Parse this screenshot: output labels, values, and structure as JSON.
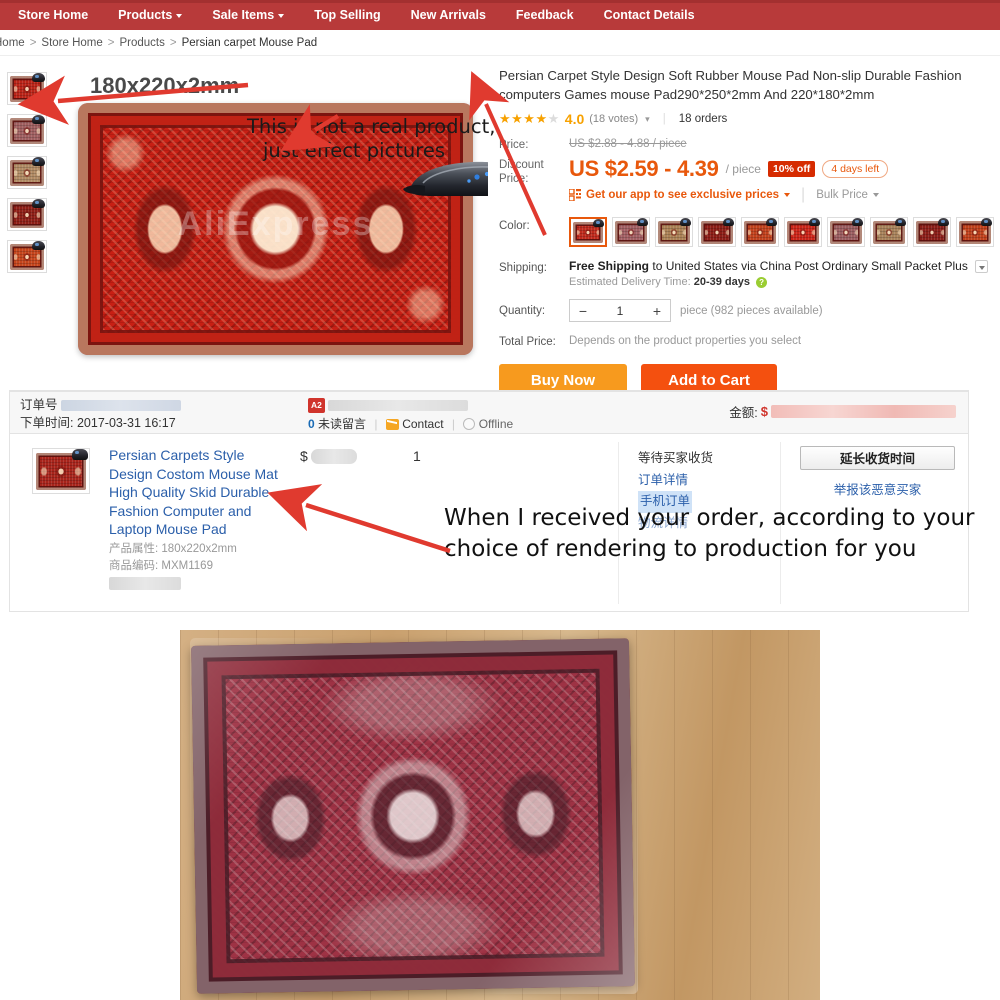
{
  "nav": {
    "items": [
      {
        "label": "Store Home",
        "has_caret": false
      },
      {
        "label": "Products",
        "has_caret": true
      },
      {
        "label": "Sale Items",
        "has_caret": true
      },
      {
        "label": "Top Selling",
        "has_caret": false
      },
      {
        "label": "New Arrivals",
        "has_caret": false
      },
      {
        "label": "Feedback",
        "has_caret": false
      },
      {
        "label": "Contact Details",
        "has_caret": false
      }
    ]
  },
  "breadcrumb": {
    "home": "Home",
    "store_home": "Store Home",
    "products": "Products",
    "current": "Persian carpet Mouse Pad",
    "separator": ">"
  },
  "annotations": {
    "top_line1": "This is not a real product,",
    "top_line2": "just effect pictures",
    "bottom": "When I received your order, according to your choice of rendering to production for you",
    "arrow_color": "#e03a2f"
  },
  "gallery": {
    "size_label": "180x220x2mm",
    "watermark": "AliExpress",
    "thumbnails": [
      {
        "name": "thumb-red-medallion",
        "color": "#b9261c"
      },
      {
        "name": "thumb-rose-gray",
        "color": "#9e5a5c"
      },
      {
        "name": "thumb-tan-beige",
        "color": "#a9apparent"
      },
      {
        "name": "thumb-dark-red",
        "color": "#8e1f18"
      },
      {
        "name": "thumb-orange-red",
        "color": "#c3421c"
      }
    ]
  },
  "product": {
    "title": "Persian Carpet Style Design Soft Rubber Mouse Pad Non-slip Durable Fashion computers Games mouse Pad290*250*2mm And 220*180*2mm",
    "rating": "4.0",
    "stars_filled": 4,
    "stars_total": 5,
    "votes": "(18 votes)",
    "orders": "18 orders",
    "price_label": "Price:",
    "original_price": "US $2.88 - 4.88 / piece",
    "discount_label_line1": "Discount",
    "discount_label_line2": "Price:",
    "discount_price": "US $2.59 - 4.39",
    "per_unit": "/ piece",
    "discount_badge": "10% off",
    "time_left_badge": "4 days left",
    "app_promo": "Get our app to see exclusive prices",
    "bulk_price": "Bulk Price",
    "color_label": "Color:",
    "shipping_label": "Shipping:",
    "shipping_free": "Free Shipping",
    "shipping_rest": "to United States via China Post Ordinary Small Packet Plus",
    "edt_label": "Estimated Delivery Time:",
    "edt_value": "20-39 days",
    "quantity_label": "Quantity:",
    "quantity_value": "1",
    "quantity_minus": "−",
    "quantity_plus": "+",
    "quantity_note": "piece (982 pieces available)",
    "total_price_label": "Total Price:",
    "total_price_value": "Depends on the product properties you select",
    "buy_now": "Buy Now",
    "add_to_cart": "Add to Cart",
    "accent_orange": "#e8580c",
    "buy_now_color": "#f79a1e",
    "add_cart_color": "#f4500f"
  },
  "order": {
    "order_no_label": "订单号",
    "order_time_label": "下单时间:",
    "order_time_value": "2017-03-31 16:17",
    "a2_badge": "A2",
    "unread_count": "0",
    "unread_label": "未读留言",
    "contact": "Contact",
    "offline": "Offline",
    "amount_label": "金额:",
    "amount_currency": "$",
    "item": {
      "title": "Persian Carpets Style Design Costom Mouse Mat High Quality Skid Durable Fashion Computer and Laptop Mouse Pad",
      "attr_label": "产品属性:",
      "attr_value": "180x220x2mm",
      "sku_label": "商品编码:",
      "sku_value": "MXM1169",
      "price_currency": "$",
      "quantity": "1"
    },
    "status": {
      "waiting": "等待买家收货",
      "detail_link": "订单详情",
      "mobile_tag": "手机订单",
      "hidden_link": "物流详情"
    },
    "actions": {
      "extend": "延长收货时间",
      "report": "举报该恶意买家"
    }
  }
}
